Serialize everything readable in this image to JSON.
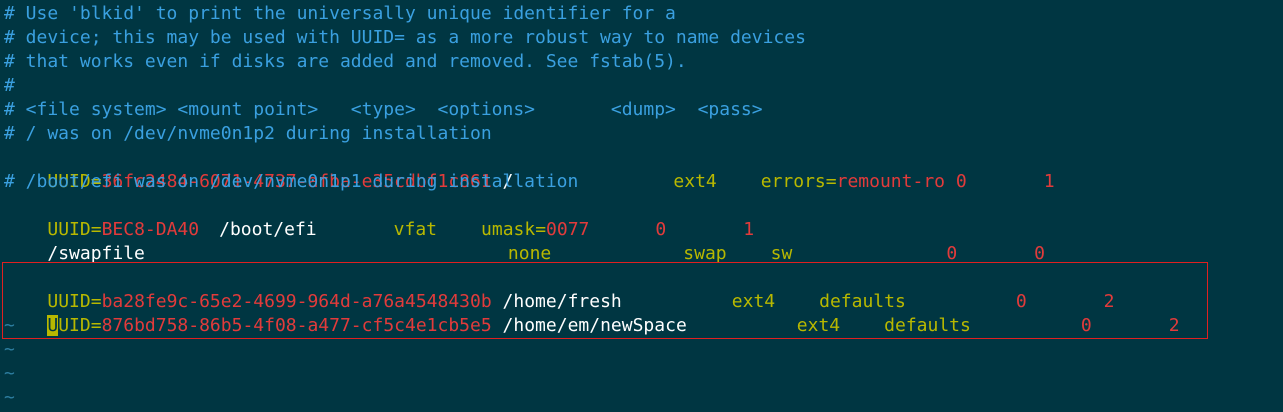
{
  "comments": {
    "c1": "# Use 'blkid' to print the universally unique identifier for a",
    "c2": "# device; this may be used with UUID= as a more robust way to name devices",
    "c3": "# that works even if disks are added and removed. See fstab(5).",
    "c4": "#",
    "c5": "# <file system> <mount point>   <type>  <options>       <dump>  <pass>",
    "c6": "# / was on /dev/nvme0n1p2 during installation",
    "c7": "# /boot/efi was on /dev/nvme0n1p1 during installation"
  },
  "entries": {
    "root": {
      "key": "UUID",
      "eq": "=",
      "uuid": "36fc2484-6071-4737-afba-e35cdbf1c861",
      "mount": "/",
      "type": "ext4",
      "opt_key": "errors",
      "opt_eq": "=",
      "opt_val": "remount-ro",
      "dump": "0",
      "pass": "1"
    },
    "efi": {
      "key": "UUID",
      "eq": "=",
      "uuid": "BEC8-DA40",
      "mount": "/boot/efi",
      "type": "vfat",
      "opt_key": "umask",
      "opt_eq": "=",
      "opt_val": "0077",
      "dump": "0",
      "pass": "1"
    },
    "swap": {
      "device": "/swapfile",
      "mount": "none",
      "type": "swap",
      "opt": "sw",
      "dump": "0",
      "pass": "0"
    },
    "fresh": {
      "key": "UUID",
      "eq": "=",
      "uuid": "ba28fe9c-65e2-4699-964d-a76a4548430b",
      "mount": "/home/fresh",
      "type": "ext4",
      "opt": "defaults",
      "dump": "0",
      "pass": "2"
    },
    "newspace": {
      "key_cursor": "U",
      "key_rest": "UID",
      "eq": "=",
      "uuid": "876bd758-86b5-4f08-a477-cf5c4e1cb5e5",
      "mount": "/home/em/newSpace",
      "type": "ext4",
      "opt": "defaults",
      "dump": "0",
      "pass": "2"
    }
  },
  "tilde": "~",
  "colors": {
    "background": "#003642",
    "comment": "#3aa0e0",
    "keyword": "#b8b800",
    "value": "#e23b3b",
    "text": "#ffffff",
    "selection_border": "#e02020"
  }
}
